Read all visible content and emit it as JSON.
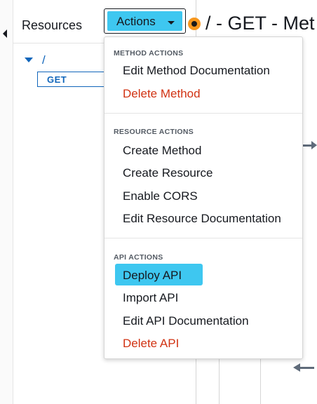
{
  "sidebar": {
    "title": "Resources",
    "tree": {
      "root_label": "/",
      "method_label": "GET"
    }
  },
  "header": {
    "actions_label": "Actions",
    "method_title": "/ - GET - Met"
  },
  "menu": {
    "groups": [
      {
        "header": "METHOD ACTIONS",
        "items": [
          {
            "label": "Edit Method Documentation",
            "variant": "normal"
          },
          {
            "label": "Delete Method",
            "variant": "danger"
          }
        ]
      },
      {
        "header": "RESOURCE ACTIONS",
        "items": [
          {
            "label": "Create Method",
            "variant": "normal"
          },
          {
            "label": "Create Resource",
            "variant": "normal"
          },
          {
            "label": "Enable CORS",
            "variant": "normal"
          },
          {
            "label": "Edit Resource Documentation",
            "variant": "normal"
          }
        ]
      },
      {
        "header": "API ACTIONS",
        "items": [
          {
            "label": "Deploy API",
            "variant": "highlighted"
          },
          {
            "label": "Import API",
            "variant": "normal"
          },
          {
            "label": "Edit API Documentation",
            "variant": "normal"
          },
          {
            "label": "Delete API",
            "variant": "danger"
          }
        ]
      }
    ]
  },
  "colors": {
    "highlight": "#3ec7f0",
    "danger": "#d13212",
    "link": "#1166bb",
    "method_dot": "#f7971e"
  }
}
